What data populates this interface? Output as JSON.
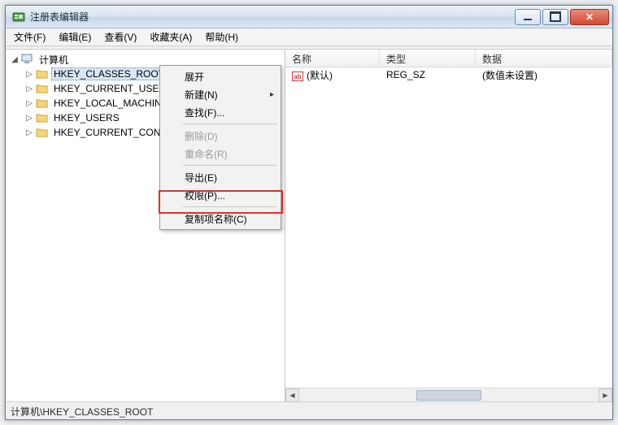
{
  "window": {
    "title": "注册表编辑器"
  },
  "menu": {
    "file": "文件(F)",
    "edit": "编辑(E)",
    "view": "查看(V)",
    "favorites": "收藏夹(A)",
    "help": "帮助(H)"
  },
  "tree": {
    "root": "计算机",
    "items": [
      "HKEY_CLASSES_ROOT",
      "HKEY_CURRENT_USER",
      "HKEY_LOCAL_MACHINE",
      "HKEY_USERS",
      "HKEY_CURRENT_CONFIG"
    ],
    "selected_index": 0
  },
  "list": {
    "headers": {
      "name": "名称",
      "type": "类型",
      "data": "数据"
    },
    "rows": [
      {
        "name": "(默认)",
        "type": "REG_SZ",
        "data": "(数值未设置)"
      }
    ]
  },
  "context_menu": {
    "expand": "展开",
    "new": "新建(N)",
    "find": "查找(F)...",
    "delete": "删除(D)",
    "rename": "重命名(R)",
    "export": "导出(E)",
    "permissions": "权限(P)...",
    "copy_key_name": "复制项名称(C)"
  },
  "statusbar": {
    "path": "计算机\\HKEY_CLASSES_ROOT"
  }
}
